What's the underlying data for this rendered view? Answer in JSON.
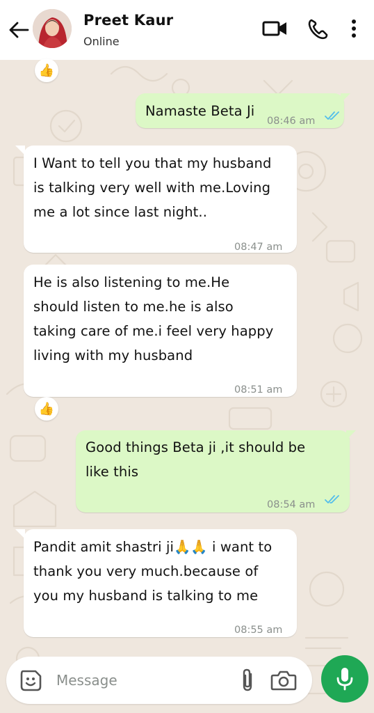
{
  "header": {
    "contact_name": "Preet Kaur",
    "status": "Online",
    "back_icon": "arrow-left-icon",
    "actions": [
      "video-call-icon",
      "voice-call-icon",
      "more-vert-icon"
    ]
  },
  "messages": [
    {
      "direction": "outgoing",
      "lines": [
        "Namaste Beta Ji"
      ],
      "time": "08:46 am",
      "read": true
    },
    {
      "direction": "incoming",
      "lines": [
        "I Want to tell you that my husband",
        "is talking very well with me.Loving",
        "me a lot since last night.."
      ],
      "time": "08:47 am"
    },
    {
      "direction": "incoming",
      "lines": [
        "He is also listening to me.He",
        "should listen to me.he is also",
        "taking care of me.i feel very happy",
        "living with my husband"
      ],
      "time": "08:51 am"
    },
    {
      "direction": "outgoing",
      "lines": [
        "Good things Beta ji ,it should be",
        "like this"
      ],
      "time": "08:54 am",
      "read": true
    },
    {
      "direction": "incoming",
      "lines": [
        "Pandit amit shastri ji🙏🙏 i want to",
        "thank you very much.because of",
        "you my husband is talking to me"
      ],
      "time": "08:55 am"
    }
  ],
  "reactions": [
    "👍",
    "👍"
  ],
  "composer": {
    "placeholder": "Message",
    "left_icon": "sticker-icon",
    "attach_icon": "paperclip-icon",
    "camera_icon": "camera-icon",
    "send_icon": "microphone-icon"
  },
  "colors": {
    "wallpaper": "#efe7de",
    "outgoing_bubble": "#dcf8c6",
    "incoming_bubble": "#ffffff",
    "read_ticks": "#53bdeb",
    "mic_button": "#1fa855"
  }
}
